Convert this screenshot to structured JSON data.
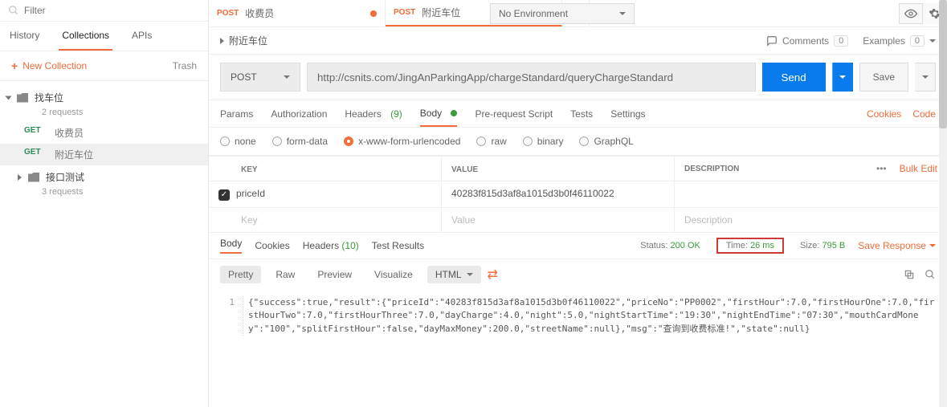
{
  "filter": {
    "placeholder": "Filter"
  },
  "sidebar_tabs": {
    "history": "History",
    "collections": "Collections",
    "apis": "APIs"
  },
  "new_collection": "New Collection",
  "trash": "Trash",
  "collections": [
    {
      "name": "找车位",
      "requests_label": "2 requests",
      "items": [
        {
          "method": "GET",
          "name": "收费员"
        },
        {
          "method": "GET",
          "name": "附近车位"
        }
      ]
    },
    {
      "name": "接口测试",
      "requests_label": "3 requests",
      "items": []
    }
  ],
  "req_tabs": [
    {
      "method": "POST",
      "name": "收费员",
      "dirty": true
    },
    {
      "method": "POST",
      "name": "附近车位",
      "dirty": true
    }
  ],
  "env": {
    "label": "No Environment"
  },
  "breadcrumb": "附近车位",
  "top_right": {
    "comments": "Comments",
    "comments_count": "0",
    "examples": "Examples",
    "examples_count": "0"
  },
  "url_row": {
    "method": "POST",
    "url": "http://csnits.com/JingAnParkingApp/chargeStandard/queryChargeStandard",
    "send": "Send",
    "save": "Save"
  },
  "rdtabs": {
    "params": "Params",
    "auth": "Authorization",
    "headers": "Headers",
    "headers_count": "(9)",
    "body": "Body",
    "prereq": "Pre-request Script",
    "tests": "Tests",
    "settings": "Settings",
    "cookies": "Cookies",
    "code": "Code"
  },
  "body_types": {
    "none": "none",
    "formdata": "form-data",
    "xwww": "x-www-form-urlencoded",
    "raw": "raw",
    "binary": "binary",
    "graphql": "GraphQL"
  },
  "ptable": {
    "hdr_key": "KEY",
    "hdr_value": "VALUE",
    "hdr_desc": "DESCRIPTION",
    "bulk": "Bulk Edit",
    "rows": [
      {
        "key": "priceId",
        "value": "40283f815d3af8a1015d3b0f46110022"
      }
    ],
    "new_key": "Key",
    "new_val": "Value",
    "new_desc": "Description"
  },
  "resp": {
    "tabs": {
      "body": "Body",
      "cookies": "Cookies",
      "headers": "Headers",
      "headers_count": "(10)",
      "test": "Test Results"
    },
    "status_label": "Status:",
    "status": "200 OK",
    "time_label": "Time:",
    "time": "26 ms",
    "size_label": "Size:",
    "size": "795 B",
    "save": "Save Response",
    "fmt": {
      "pretty": "Pretty",
      "raw": "Raw",
      "preview": "Preview",
      "visualize": "Visualize",
      "html": "HTML"
    },
    "line": "1",
    "json": "{\"success\":true,\"result\":{\"priceId\":\"40283f815d3af8a1015d3b0f46110022\",\"priceNo\":\"PP0002\",\"firstHour\":7.0,\"firstHourOne\":7.0,\"firstHourTwo\":7.0,\"firstHourThree\":7.0,\"dayCharge\":4.0,\"night\":5.0,\"nightStartTime\":\"19:30\",\"nightEndTime\":\"07:30\",\"mouthCardMoney\":\"100\",\"splitFirstHour\":false,\"dayMaxMoney\":200.0,\"streetName\":null},\"msg\":\"查询到收费标准!\",\"state\":null}"
  }
}
